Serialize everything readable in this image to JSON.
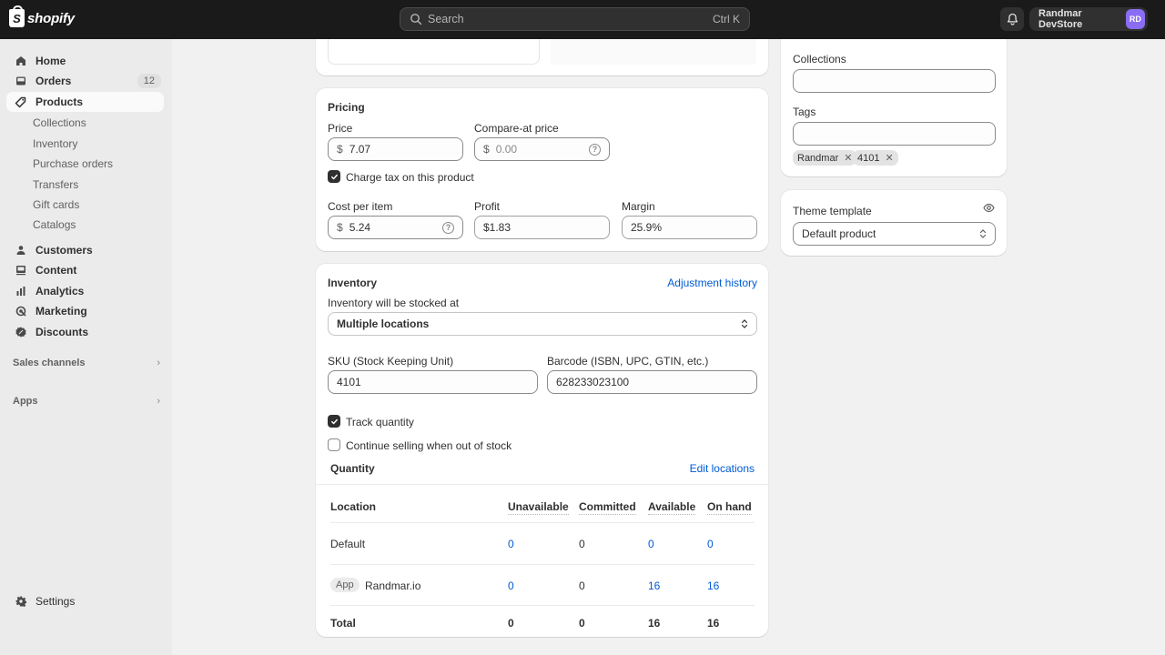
{
  "topbar": {
    "brand": "shopify",
    "search_placeholder": "Search",
    "search_shortcut": "Ctrl K",
    "store_name": "Randmar DevStore",
    "avatar_initials": "RD",
    "avatar_color": "#8a6cf5"
  },
  "sidebar": {
    "items": [
      {
        "label": "Home",
        "icon": "home-icon"
      },
      {
        "label": "Orders",
        "icon": "inbox-icon",
        "badge": "12"
      },
      {
        "label": "Products",
        "icon": "tag-icon",
        "active": true
      },
      {
        "label": "Customers",
        "icon": "person-icon"
      },
      {
        "label": "Content",
        "icon": "content-icon"
      },
      {
        "label": "Analytics",
        "icon": "bar-chart-icon"
      },
      {
        "label": "Marketing",
        "icon": "target-icon"
      },
      {
        "label": "Discounts",
        "icon": "discount-icon"
      }
    ],
    "product_subitems": [
      "Collections",
      "Inventory",
      "Purchase orders",
      "Transfers",
      "Gift cards",
      "Catalogs"
    ],
    "sections": {
      "sales_channels": "Sales channels",
      "apps": "Apps"
    },
    "settings": "Settings"
  },
  "pricing": {
    "title": "Pricing",
    "price_label": "Price",
    "price_value": "7.07",
    "compare_label": "Compare-at price",
    "compare_value": "0.00",
    "currency": "$",
    "charge_tax_label": "Charge tax on this product",
    "charge_tax_checked": true,
    "cost_label": "Cost per item",
    "cost_value": "5.24",
    "profit_label": "Profit",
    "profit_value": "$1.83",
    "margin_label": "Margin",
    "margin_value": "25.9%"
  },
  "inventory": {
    "title": "Inventory",
    "adjustment_history": "Adjustment history",
    "stocked_at_label": "Inventory will be stocked at",
    "stocked_at_value": "Multiple locations",
    "sku_label": "SKU (Stock Keeping Unit)",
    "sku_value": "4101",
    "barcode_label": "Barcode (ISBN, UPC, GTIN, etc.)",
    "barcode_value": "628233023100",
    "track_quantity_label": "Track quantity",
    "track_quantity_checked": true,
    "continue_selling_label": "Continue selling when out of stock",
    "continue_selling_checked": false,
    "quantity_title": "Quantity",
    "edit_locations": "Edit locations",
    "table": {
      "headers": [
        "Location",
        "Unavailable",
        "Committed",
        "Available",
        "On hand"
      ],
      "rows": [
        {
          "location": "Default",
          "badge": "",
          "unavailable": "0",
          "committed": "0",
          "available": "0",
          "on_hand": "0"
        },
        {
          "location": "Randmar.io",
          "badge": "App",
          "unavailable": "0",
          "committed": "0",
          "available": "16",
          "on_hand": "16"
        }
      ],
      "total": {
        "label": "Total",
        "unavailable": "0",
        "committed": "0",
        "available": "16",
        "on_hand": "16"
      }
    }
  },
  "organization": {
    "collections_label": "Collections",
    "collections_value": "",
    "tags_label": "Tags",
    "tags_value": "",
    "tags": [
      "Randmar",
      "4101"
    ]
  },
  "theme": {
    "label": "Theme template",
    "value": "Default product"
  }
}
